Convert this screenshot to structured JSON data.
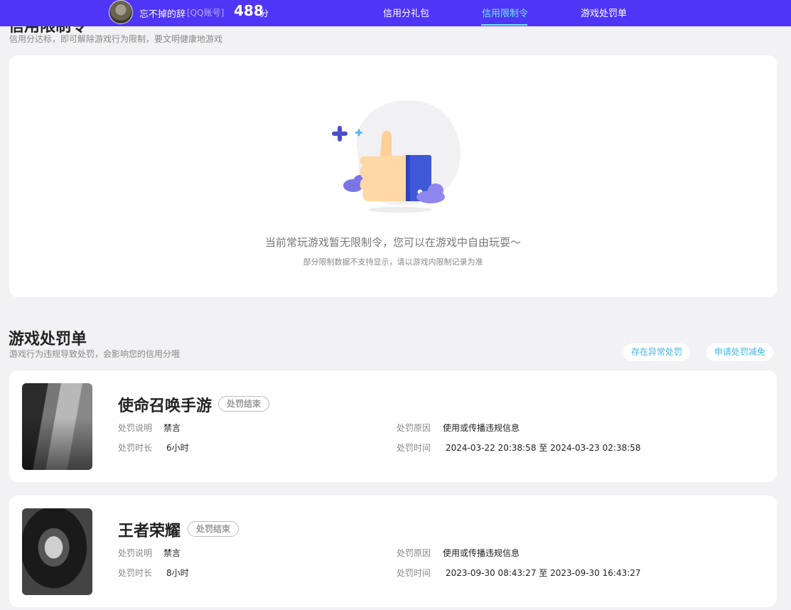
{
  "header": {
    "username": "忘不掉的辞",
    "account_type": "[QQ账号]",
    "score": "488",
    "score_unit": "分",
    "tabs": [
      {
        "label": "信用分礼包"
      },
      {
        "label": "信用限制令"
      },
      {
        "label": "游戏处罚单"
      }
    ],
    "active_tab": "信用限制令",
    "accent_color": "#4f35f5",
    "active_color": "#6fe8ff"
  },
  "restriction": {
    "title": "信用限制令",
    "subtitle": "信用分达标，即可解除游戏行为限制，要文明健康地游戏",
    "empty_message": "当前常玩游戏暂无限制令，您可以在游戏中自由玩耍～",
    "empty_note": "部分限制数据不支持显示，请以游戏内限制记录为准",
    "illustration_icon": "thumbs-up-icon"
  },
  "penalty": {
    "title": "游戏处罚单",
    "subtitle": "游戏行为违规导致处罚，会影响您的信用分哦",
    "buttons": {
      "abnormal": "存在异常处罚",
      "appeal": "申请处罚减免"
    },
    "labels": {
      "desc": "处罚说明",
      "duration": "处罚时长",
      "reason": "处罚原因",
      "time": "处罚时间"
    },
    "items": [
      {
        "game": "使命召唤手游",
        "status": "处罚结束",
        "desc": "禁言",
        "duration": "6小时",
        "reason": "使用或传播违规信息",
        "time": "2024-03-22 20:38:58 至 2024-03-23 02:38:58"
      },
      {
        "game": "王者荣耀",
        "status": "处罚结束",
        "desc": "禁言",
        "duration": "8小时",
        "reason": "使用或传播违规信息",
        "time": "2023-09-30 08:43:27 至 2023-09-30 16:43:27"
      }
    ]
  }
}
